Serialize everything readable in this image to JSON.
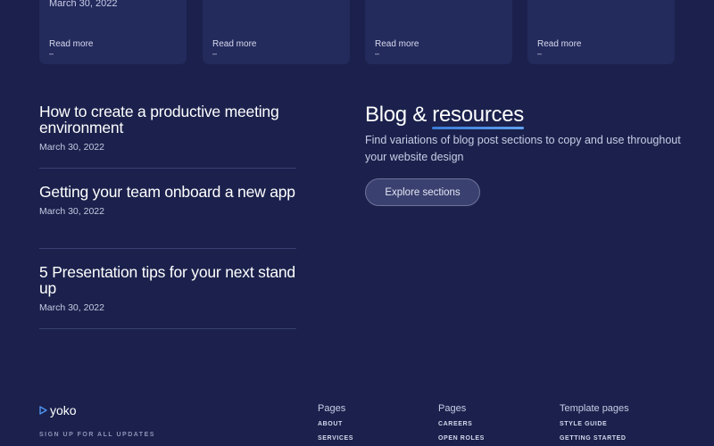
{
  "top_cards": [
    {
      "date": "March 30, 2022",
      "read_more": "Read more",
      "dash": "–"
    },
    {
      "date": "",
      "read_more": "Read more",
      "dash": "–"
    },
    {
      "date": "",
      "read_more": "Read more",
      "dash": "–"
    },
    {
      "date": "",
      "read_more": "Read more",
      "dash": "–"
    }
  ],
  "posts": [
    {
      "title": "How to create a productive meeting environment",
      "date": "March 30, 2022"
    },
    {
      "title": "Getting your team onboard a new app",
      "date": "March 30, 2022"
    },
    {
      "title": "5 Presentation tips for your next stand up",
      "date": "March 30, 2022"
    }
  ],
  "blog": {
    "heading_prefix": "Blog & ",
    "heading_highlight": "resources",
    "description": "Find variations of blog post sections to copy and use throughout your website design",
    "explore_label": "Explore sections"
  },
  "footer": {
    "logo_text": "yoko",
    "signup_label": "SIGN UP FOR ALL UPDATES",
    "columns": [
      {
        "heading": "Pages",
        "links": [
          "ABOUT",
          "SERVICES"
        ]
      },
      {
        "heading": "Pages",
        "links": [
          "CAREERS",
          "OPEN ROLES"
        ]
      },
      {
        "heading": "Template pages",
        "links": [
          "STYLE GUIDE",
          "GETTING STARTED"
        ]
      }
    ]
  },
  "colors": {
    "background": "#1b214c",
    "card": "#232a5c",
    "accent": "#3b7bd6"
  }
}
